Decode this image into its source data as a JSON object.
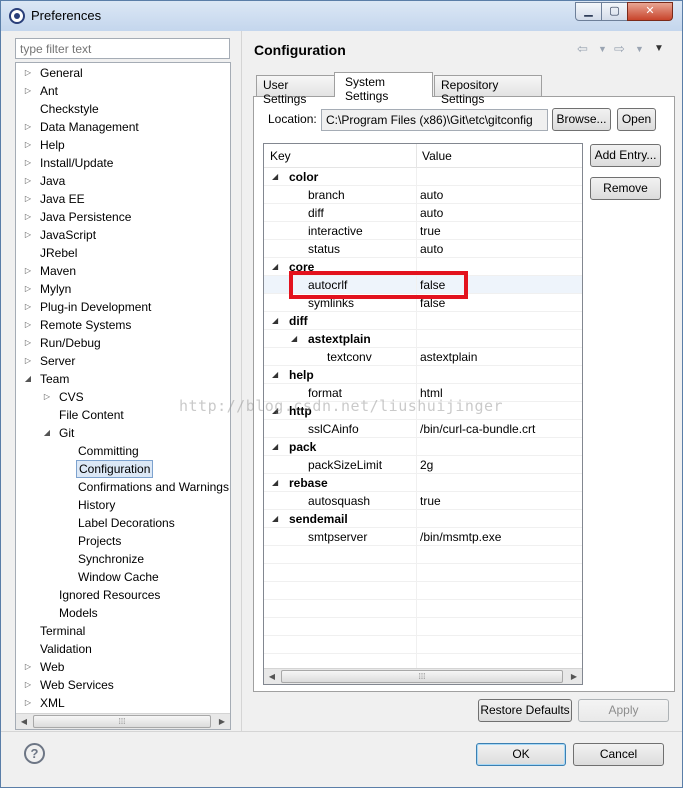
{
  "window": {
    "title": "Preferences"
  },
  "icons": {
    "app": "eclipse-icon",
    "minimize": "minimize-icon",
    "maximize": "maximize-icon",
    "close": "close-icon",
    "back": "back-arrow-icon",
    "forward": "forward-arrow-icon",
    "menu": "view-menu-icon",
    "help": "help-icon"
  },
  "filter": {
    "placeholder": "type filter text"
  },
  "tree": [
    {
      "label": "General",
      "depth": 0,
      "expandable": true
    },
    {
      "label": "Ant",
      "depth": 0,
      "expandable": true
    },
    {
      "label": "Checkstyle",
      "depth": 0,
      "expandable": false
    },
    {
      "label": "Data Management",
      "depth": 0,
      "expandable": true
    },
    {
      "label": "Help",
      "depth": 0,
      "expandable": true
    },
    {
      "label": "Install/Update",
      "depth": 0,
      "expandable": true
    },
    {
      "label": "Java",
      "depth": 0,
      "expandable": true
    },
    {
      "label": "Java EE",
      "depth": 0,
      "expandable": true
    },
    {
      "label": "Java Persistence",
      "depth": 0,
      "expandable": true
    },
    {
      "label": "JavaScript",
      "depth": 0,
      "expandable": true
    },
    {
      "label": "JRebel",
      "depth": 0,
      "expandable": false
    },
    {
      "label": "Maven",
      "depth": 0,
      "expandable": true
    },
    {
      "label": "Mylyn",
      "depth": 0,
      "expandable": true
    },
    {
      "label": "Plug-in Development",
      "depth": 0,
      "expandable": true
    },
    {
      "label": "Remote Systems",
      "depth": 0,
      "expandable": true
    },
    {
      "label": "Run/Debug",
      "depth": 0,
      "expandable": true
    },
    {
      "label": "Server",
      "depth": 0,
      "expandable": true
    },
    {
      "label": "Team",
      "depth": 0,
      "expandable": true,
      "expanded": true
    },
    {
      "label": "CVS",
      "depth": 1,
      "expandable": true
    },
    {
      "label": "File Content",
      "depth": 1,
      "expandable": false
    },
    {
      "label": "Git",
      "depth": 1,
      "expandable": true,
      "expanded": true
    },
    {
      "label": "Committing",
      "depth": 2,
      "expandable": false
    },
    {
      "label": "Configuration",
      "depth": 2,
      "expandable": false,
      "selected": true
    },
    {
      "label": "Confirmations and Warnings",
      "depth": 2,
      "expandable": false
    },
    {
      "label": "History",
      "depth": 2,
      "expandable": false
    },
    {
      "label": "Label Decorations",
      "depth": 2,
      "expandable": false
    },
    {
      "label": "Projects",
      "depth": 2,
      "expandable": false
    },
    {
      "label": "Synchronize",
      "depth": 2,
      "expandable": false
    },
    {
      "label": "Window Cache",
      "depth": 2,
      "expandable": false
    },
    {
      "label": "Ignored Resources",
      "depth": 1,
      "expandable": false
    },
    {
      "label": "Models",
      "depth": 1,
      "expandable": false
    },
    {
      "label": "Terminal",
      "depth": 0,
      "expandable": false
    },
    {
      "label": "Validation",
      "depth": 0,
      "expandable": false
    },
    {
      "label": "Web",
      "depth": 0,
      "expandable": true
    },
    {
      "label": "Web Services",
      "depth": 0,
      "expandable": true
    },
    {
      "label": "XML",
      "depth": 0,
      "expandable": true
    }
  ],
  "page": {
    "title": "Configuration"
  },
  "tabs": [
    {
      "label": "User Settings",
      "active": false
    },
    {
      "label": "System Settings",
      "active": true
    },
    {
      "label": "Repository Settings",
      "active": false
    }
  ],
  "location": {
    "label": "Location:",
    "value": "C:\\Program Files (x86)\\Git\\etc\\gitconfig",
    "browse": "Browse...",
    "open": "Open"
  },
  "table": {
    "columns": [
      "Key",
      "Value"
    ],
    "rows": [
      {
        "key": "color",
        "value": "",
        "depth": 0,
        "section": true
      },
      {
        "key": "branch",
        "value": "auto",
        "depth": 1
      },
      {
        "key": "diff",
        "value": "auto",
        "depth": 1
      },
      {
        "key": "interactive",
        "value": "true",
        "depth": 1
      },
      {
        "key": "status",
        "value": "auto",
        "depth": 1
      },
      {
        "key": "core",
        "value": "",
        "depth": 0,
        "section": true
      },
      {
        "key": "autocrlf",
        "value": "false",
        "depth": 1,
        "highlight": true
      },
      {
        "key": "symlinks",
        "value": "false",
        "depth": 1
      },
      {
        "key": "diff",
        "value": "",
        "depth": 0,
        "section": true
      },
      {
        "key": "astextplain",
        "value": "",
        "depth": 1,
        "section": true
      },
      {
        "key": "textconv",
        "value": "astextplain",
        "depth": 2
      },
      {
        "key": "help",
        "value": "",
        "depth": 0,
        "section": true
      },
      {
        "key": "format",
        "value": "html",
        "depth": 1
      },
      {
        "key": "http",
        "value": "",
        "depth": 0,
        "section": true
      },
      {
        "key": "sslCAinfo",
        "value": "/bin/curl-ca-bundle.crt",
        "depth": 1
      },
      {
        "key": "pack",
        "value": "",
        "depth": 0,
        "section": true
      },
      {
        "key": "packSizeLimit",
        "value": "2g",
        "depth": 1
      },
      {
        "key": "rebase",
        "value": "",
        "depth": 0,
        "section": true
      },
      {
        "key": "autosquash",
        "value": "true",
        "depth": 1
      },
      {
        "key": "sendemail",
        "value": "",
        "depth": 0,
        "section": true
      },
      {
        "key": "smtpserver",
        "value": "/bin/msmtp.exe",
        "depth": 1
      }
    ]
  },
  "side_buttons": {
    "add_entry": "Add Entry...",
    "remove": "Remove"
  },
  "watermark": "http://blog.csdn.net/liushuijinger",
  "footer": {
    "restore_defaults": "Restore Defaults",
    "apply": "Apply",
    "ok": "OK",
    "cancel": "Cancel"
  }
}
